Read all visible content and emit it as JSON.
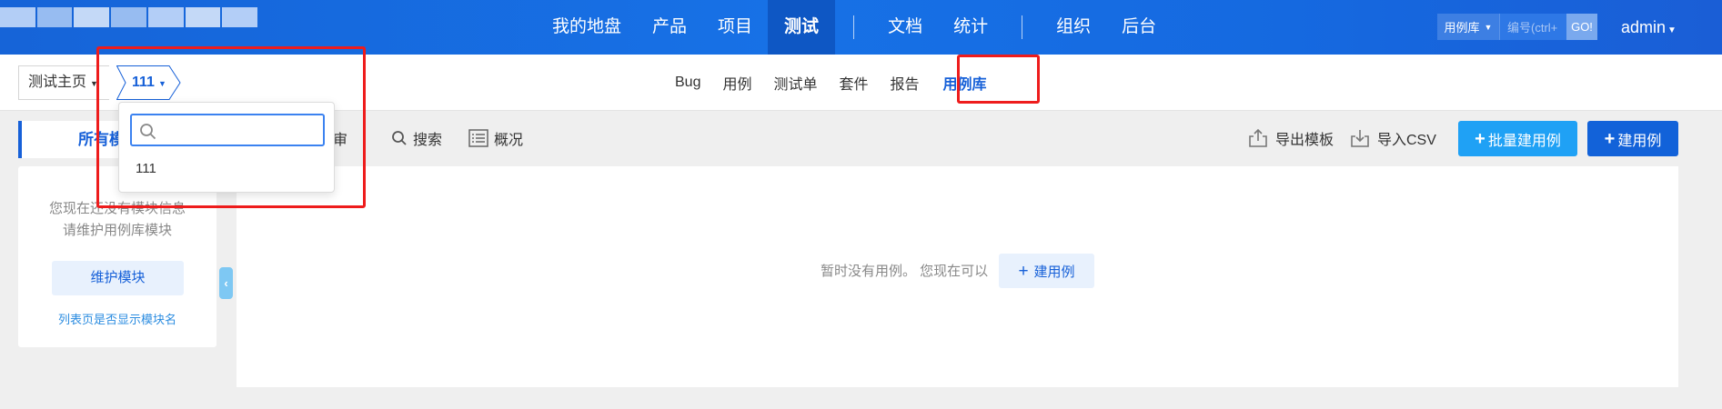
{
  "header": {
    "nav": [
      {
        "label": "我的地盘"
      },
      {
        "label": "产品"
      },
      {
        "label": "项目"
      },
      {
        "label": "测试",
        "active": true
      },
      {
        "label": "文档"
      },
      {
        "label": "统计"
      },
      {
        "label": "组织"
      },
      {
        "label": "后台"
      }
    ],
    "search": {
      "type_label": "用例库",
      "placeholder": "编号(ctrl+",
      "go_label": "GO!"
    },
    "user": "admin"
  },
  "subbar": {
    "home_label": "测试主页",
    "product_label": "111",
    "tabs": [
      {
        "label": "Bug"
      },
      {
        "label": "用例"
      },
      {
        "label": "测试单"
      },
      {
        "label": "套件"
      },
      {
        "label": "报告"
      },
      {
        "label": "用例库",
        "active": true
      }
    ]
  },
  "dropdown": {
    "search_value": "",
    "options": [
      "111"
    ]
  },
  "toolbar": {
    "module_tab": "所有模块",
    "review_label": "评审",
    "search_label": "搜索",
    "overview_label": "概况",
    "export_label": "导出模板",
    "import_label": "导入CSV",
    "batch_create_label": "批量建用例",
    "create_label": "建用例"
  },
  "sidebar": {
    "empty_line1": "您现在还没有模块信息",
    "empty_line2": "请维护用例库模块",
    "maintain_label": "维护模块",
    "show_module_link": "列表页是否显示模块名"
  },
  "main": {
    "empty_text": "暂时没有用例。 您现在可以",
    "create_label": "建用例"
  },
  "colors": {
    "primary": "#1660d8",
    "highlight": "#ee1c1c",
    "batch_button": "#1fa1f5"
  }
}
